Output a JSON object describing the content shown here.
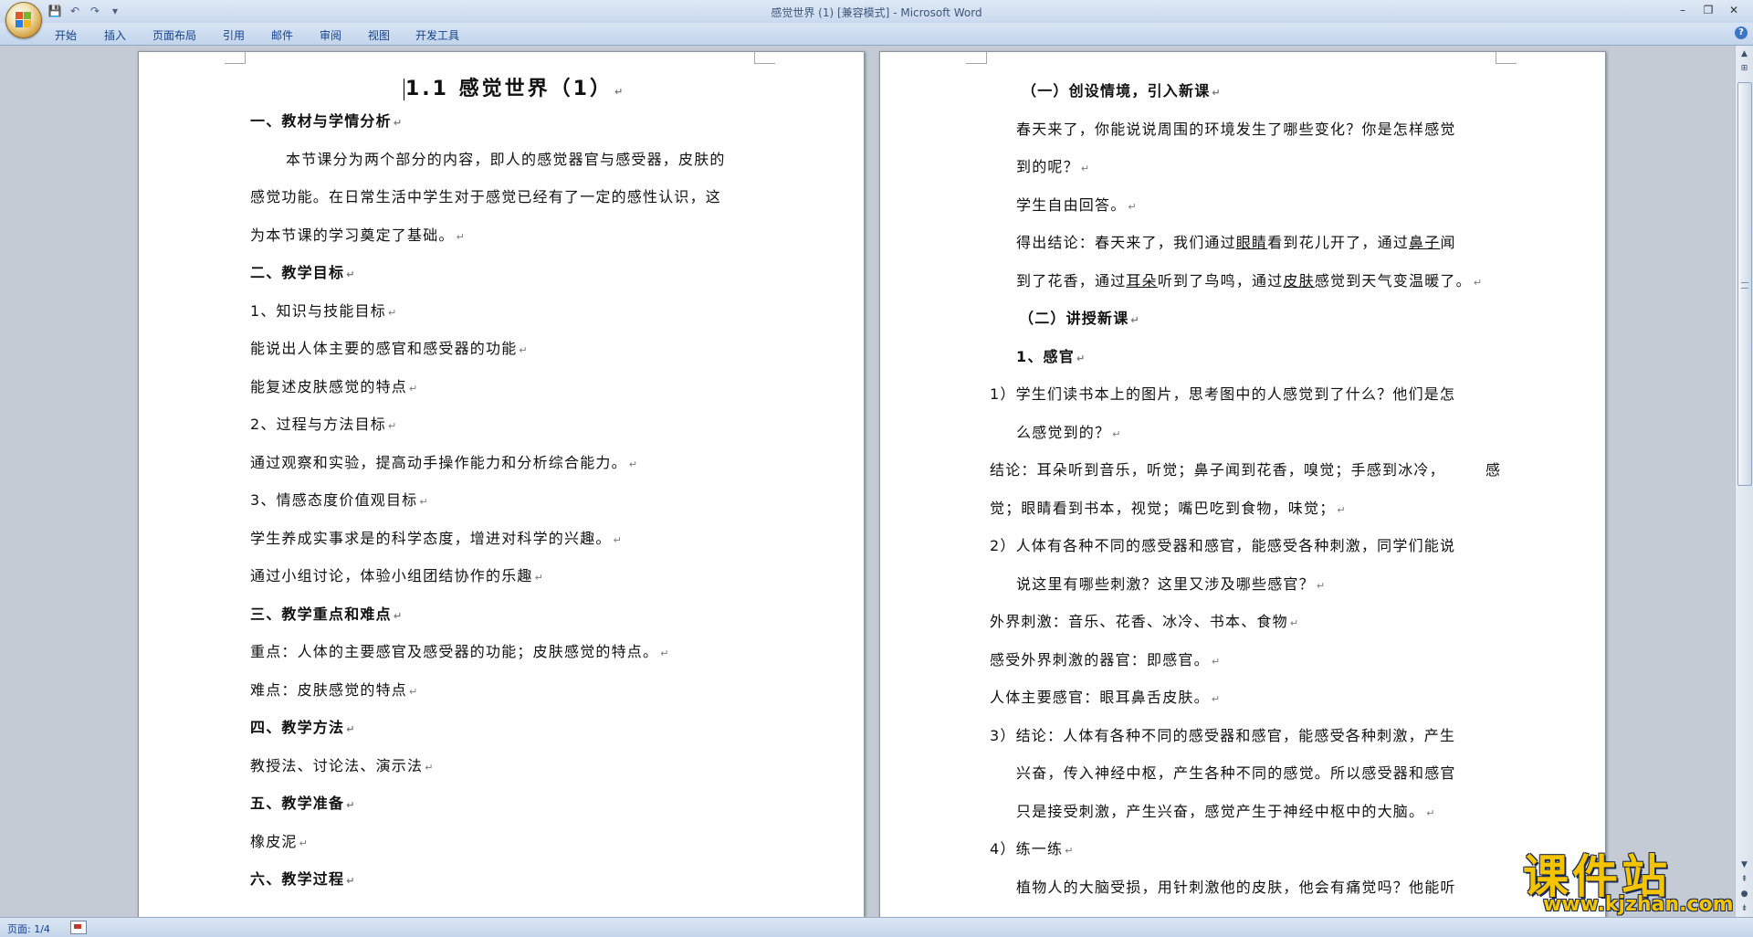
{
  "window": {
    "title": "感觉世界 (1) [兼容模式]",
    "app_name": "Microsoft Word",
    "qat": {
      "save": "💾",
      "undo": "↶",
      "redo": "↷",
      "customize": "▾"
    },
    "controls": {
      "minimize": "–",
      "restore": "❐",
      "close": "✕"
    }
  },
  "ribbon": {
    "tabs": [
      "开始",
      "插入",
      "页面布局",
      "引用",
      "邮件",
      "审阅",
      "视图",
      "开发工具"
    ],
    "help": "?"
  },
  "document": {
    "left_page": {
      "title": "1.1  感觉世界（1）",
      "lines": [
        "一、教材与学情分析",
        "本节课分为两个部分的内容，即人的感觉器官与感受器，皮肤的",
        "感觉功能。在日常生活中学生对于感觉已经有了一定的感性认识，这",
        "为本节课的学习奠定了基础。",
        "二、教学目标",
        "1、知识与技能目标",
        "能说出人体主要的感官和感受器的功能",
        "能复述皮肤感觉的特点",
        "2、过程与方法目标",
        "通过观察和实验，提高动手操作能力和分析综合能力。",
        "3、情感态度价值观目标",
        "学生养成实事求是的科学态度，增进对科学的兴趣。",
        "通过小组讨论，体验小组团结协作的乐趣",
        "三、教学重点和难点",
        "重点：人体的主要感官及感受器的功能；皮肤感觉的特点。",
        "难点：皮肤感觉的特点",
        "四、教学方法",
        "教授法、讨论法、演示法",
        "五、教学准备",
        "橡皮泥",
        "六、教学过程"
      ]
    },
    "right_page": {
      "lines": [
        "（一）创设情境，引入新课",
        "春天来了，你能说说周围的环境发生了哪些变化？你是怎样感觉",
        "到的呢？",
        "学生自由回答。",
        "得出结论：春天来了，我们通过",
        "眼睛",
        "看到花儿开了，通过",
        "鼻子",
        "闻",
        "到了花香，通过",
        "耳朵",
        "听到了鸟鸣，通过",
        "皮肤",
        "感觉到天气变温暖了。",
        "（二）讲授新课",
        "1、感官",
        "1）学生们读书本上的图片，思考图中的人感觉到了什么？他们是怎",
        "么感觉到的？",
        "结论：耳朵听到音乐，听觉；鼻子闻到花香，嗅觉；手感到冰冷，",
        "感",
        "觉；眼睛看到书本，视觉；嘴巴吃到食物，味觉；",
        "2）人体有各种不同的感受器和感官，能感受各种刺激，同学们能说",
        "说这里有哪些刺激？这里又涉及哪些感官？",
        "外界刺激：音乐、花香、冰冷、书本、食物",
        "感受外界刺激的器官：即感官。",
        "人体主要感官：眼耳鼻舌皮肤。",
        "3）结论：人体有各种不同的感受器和感官，能感受各种刺激，产生",
        "兴奋，传入神经中枢，产生各种不同的感觉。所以感受器和感官",
        "只是接受刺激，产生兴奋，感觉产生于神经中枢中的大脑。",
        "4）练一练",
        "植物人的大脑受损，用针刺激他的皮肤，他会有痛觉吗？他能听"
      ]
    },
    "paragraph_mark": "↵"
  },
  "statusbar": {
    "page_info": "页面: 1/4"
  },
  "watermark": {
    "text": "课件站",
    "url": "www.kjzhan.com"
  }
}
